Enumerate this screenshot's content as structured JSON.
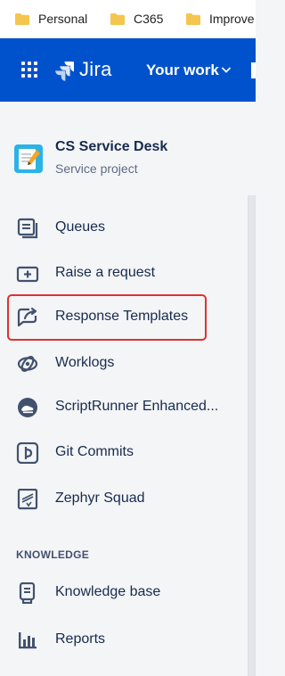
{
  "bookmarks": [
    {
      "label": "Personal",
      "icon": "folder-icon"
    },
    {
      "label": "C365",
      "icon": "folder-icon"
    },
    {
      "label": "Improve",
      "icon": "folder-icon"
    }
  ],
  "header": {
    "app_name": "Jira",
    "nav_your_work": "Your work",
    "brand_color": "#0052cc"
  },
  "project": {
    "name": "CS Service Desk",
    "type": "Service project"
  },
  "nav": {
    "items": [
      {
        "label": "Queues",
        "icon": "queues-icon"
      },
      {
        "label": "Raise a request",
        "icon": "raise-request-icon"
      },
      {
        "label": "Response Templates",
        "icon": "response-templates-icon",
        "highlighted": true
      },
      {
        "label": "Worklogs",
        "icon": "worklogs-icon"
      },
      {
        "label": "ScriptRunner Enhanced...",
        "icon": "scriptrunner-icon"
      },
      {
        "label": "Git Commits",
        "icon": "git-commits-icon"
      },
      {
        "label": "Zephyr Squad",
        "icon": "zephyr-squad-icon"
      }
    ],
    "knowledge_heading": "KNOWLEDGE",
    "knowledge_items": [
      {
        "label": "Knowledge base",
        "icon": "knowledge-base-icon"
      },
      {
        "label": "Reports",
        "icon": "reports-icon"
      }
    ]
  },
  "colors": {
    "highlight_border": "#e03131",
    "sidebar_bg": "#f4f5f7",
    "text": "#172b4d"
  }
}
